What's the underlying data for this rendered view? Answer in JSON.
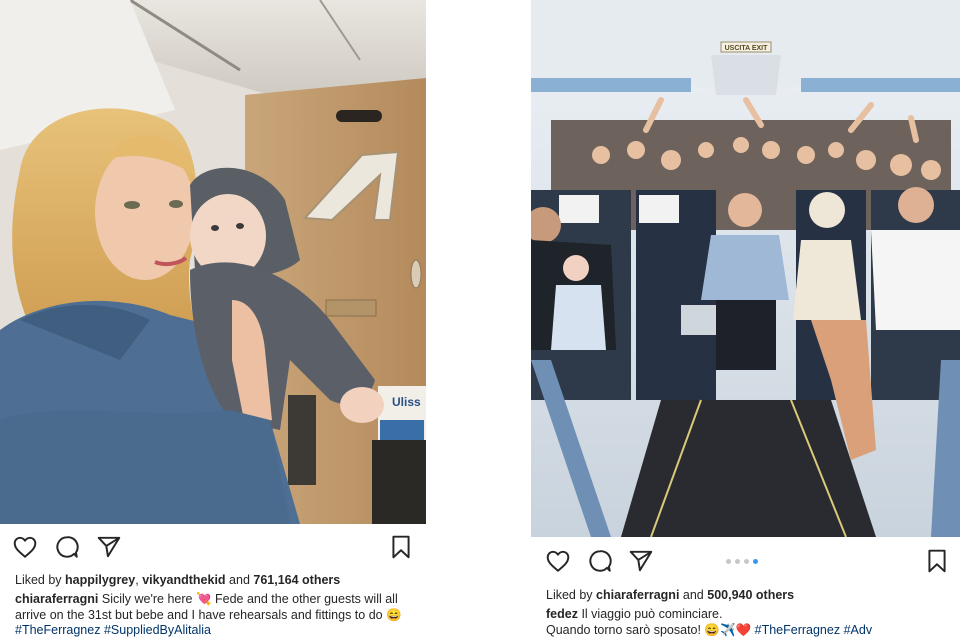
{
  "post1": {
    "liked_prefix": "Liked by",
    "liker1": "happilygrey",
    "sep1": ",",
    "liker2": "vikyandthekid",
    "and_text": "and",
    "others": "761,164 others",
    "author": "chiaraferragni",
    "caption_text": "Sicily we're here 💘 Fede and the other guests will all arrive on the 31st but bebe and I have rehearsals and fittings to do 😄",
    "hashtag1": "#TheFerragnez",
    "hashtag2": "#SuppliedByAlitalia",
    "cabin_box_text": "Uliss"
  },
  "post2": {
    "liked_prefix": "Liked by",
    "liker1": "chiaraferragni",
    "and_text": "and",
    "others": "500,940 others",
    "author": "fedez",
    "caption_line1": "Il viaggio può cominciare.",
    "caption_line2": "Quando torno sarò sposato! 😄✈️❤️",
    "hashtag1": "#TheFerragnez",
    "hashtag2": "#Adv",
    "exit_sign": "USCITA EXIT",
    "carousel_total": 4,
    "carousel_active": 4
  },
  "icons": {
    "like": "heart-icon",
    "comment": "comment-bubble-icon",
    "share": "paper-plane-icon",
    "save": "bookmark-icon"
  },
  "colors": {
    "text": "#262626",
    "hashtag": "#003569",
    "dot_active": "#3897f0",
    "dot_inactive": "#c7c7c7"
  }
}
